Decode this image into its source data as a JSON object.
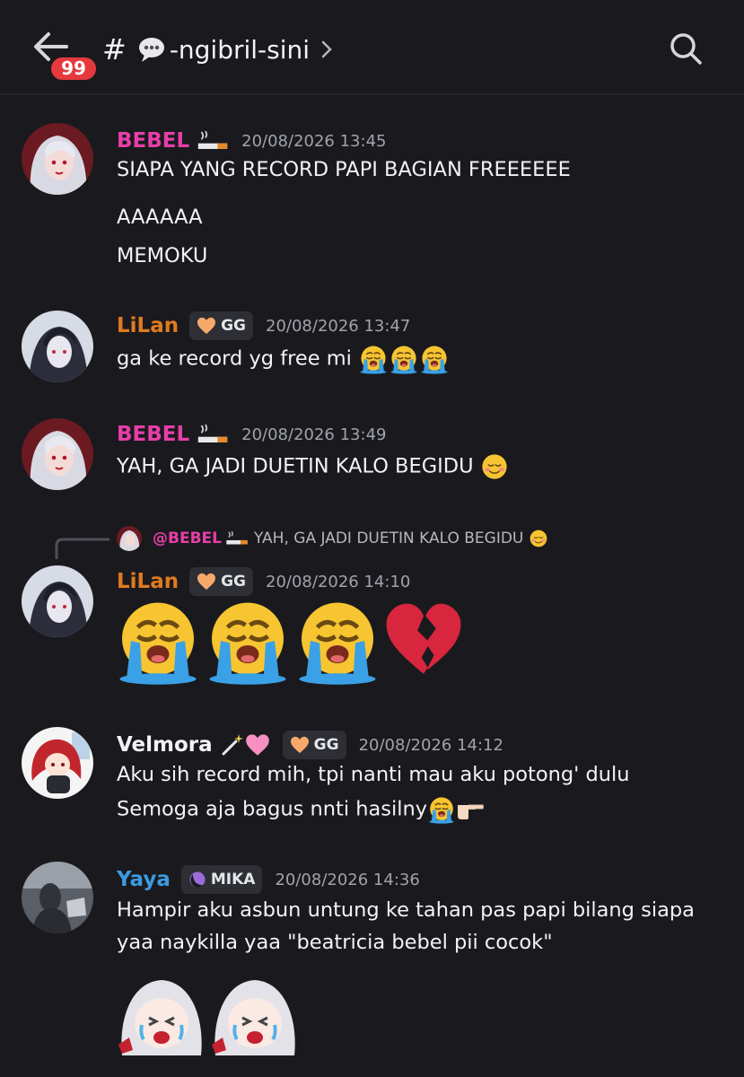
{
  "header": {
    "badge_count": "99",
    "channel_hash": "#",
    "channel_name": "-ngibril-sini"
  },
  "messages": [
    {
      "username": "BEBEL",
      "timestamp": "20/08/2026 13:45",
      "lines": [
        "SIAPA YANG RECORD PAPI BAGIAN FREEEEEE",
        "AAAAAA",
        "MEMOKU"
      ]
    },
    {
      "username": "LiLan",
      "tag": "GG",
      "timestamp": "20/08/2026 13:47",
      "lines": [
        "ga ke record yg free mi"
      ]
    },
    {
      "username": "BEBEL",
      "timestamp": "20/08/2026 13:49",
      "lines": [
        "YAH, GA JADI DUETIN KALO BEGIDU"
      ]
    },
    {
      "reply": {
        "mention": "@BEBEL",
        "text": "YAH, GA JADI DUETIN KALO BEGIDU"
      },
      "username": "LiLan",
      "tag": "GG",
      "timestamp": "20/08/2026 14:10"
    },
    {
      "username": "Velmora",
      "tag": "GG",
      "timestamp": "20/08/2026 14:12",
      "lines": [
        "Aku sih record mih, tpi nanti mau aku potong' dulu",
        "Semoga aja bagus nnti hasilny"
      ]
    },
    {
      "username": "Yaya",
      "tag": "MIKA",
      "timestamp": "20/08/2026 14:36",
      "lines": [
        "Hampir aku asbun untung ke tahan pas papi bilang siapa",
        "yaa naykilla yaa \"beatricia bebel pii cocok\""
      ]
    }
  ],
  "colors": {
    "background": "#1a1a1e",
    "bebel": "#e83ea8",
    "lilan": "#e07a1f",
    "velmora": "#f2f3f5",
    "yaya": "#3b9be0",
    "timestamp": "#a0a3ab"
  },
  "icons": [
    "back-arrow-icon",
    "search-icon",
    "speech-bubble-icon",
    "chevron-right-icon",
    "cigarette-icon",
    "heart-icon",
    "moon-icon",
    "crying-emoji-icon",
    "broken-heart-icon",
    "smiling-emoji-icon",
    "pointing-hand-icon",
    "magic-wand-icon",
    "pink-heart-icon"
  ]
}
